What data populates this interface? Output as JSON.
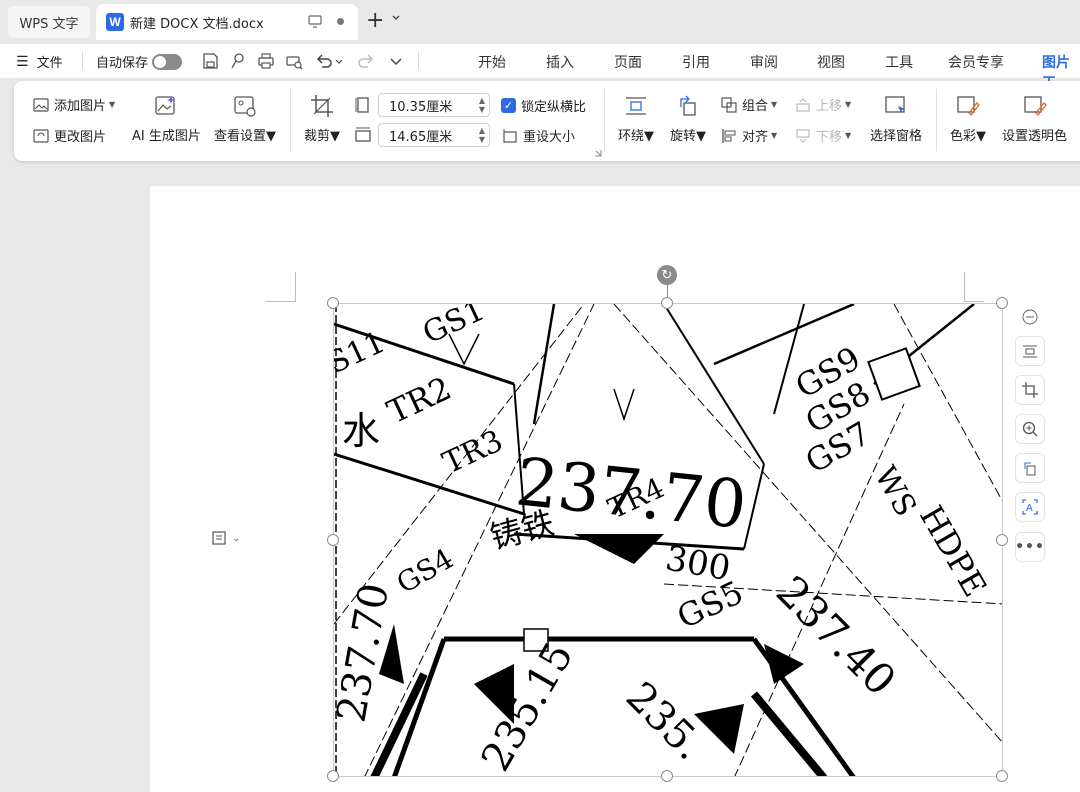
{
  "tabs": {
    "wps_label": "WPS 文字",
    "doc_label": "新建 DOCX 文档.docx",
    "new_tab": "+"
  },
  "menu": {
    "file_label": "文件",
    "autosave_label": "自动保存",
    "tabs": [
      "开始",
      "插入",
      "页面",
      "引用",
      "审阅",
      "视图",
      "工具",
      "会员专享",
      "图片工"
    ]
  },
  "ribbon": {
    "add_image": "添加图片",
    "change_image": "更改图片",
    "ai_generate": "AI 生成图片",
    "view_settings": "查看设置",
    "crop": "裁剪",
    "width_value": "10.35厘米",
    "height_value": "14.65厘米",
    "lock_ratio": "锁定纵横比",
    "reset_size": "重设大小",
    "wrap": "环绕",
    "rotate": "旋转",
    "group": "组合",
    "align": "对齐",
    "move_up": "上移",
    "move_down": "下移",
    "selection_pane": "选择窗格",
    "color": "色彩",
    "transparent": "设置透明色"
  },
  "drawing_text": {
    "t1": "237.70",
    "t2": "TR2",
    "t3": "GS9",
    "t4": "GS8",
    "t5": "GS7",
    "t6": "GS5",
    "t7": "235.15",
    "t8": "237.40",
    "t9": "HDPE",
    "t10": "300",
    "t11": "铸铁",
    "t12": "S11",
    "t13": "水",
    "t14": "TR4",
    "t15": "GS4",
    "t16": "235.",
    "t17": "237.70",
    "t18": "WS",
    "t19": "GS1",
    "t20": "TR3"
  },
  "colors": {
    "accent": "#2b6ce5",
    "toggle_off": "#8a8a8a"
  }
}
